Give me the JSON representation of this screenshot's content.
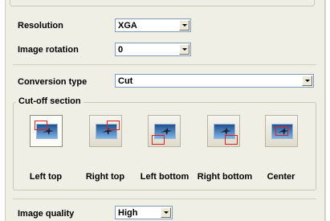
{
  "resolution": {
    "label": "Resolution",
    "value": "XGA"
  },
  "image_rotation": {
    "label": "Image rotation",
    "value": "0"
  },
  "conversion_type": {
    "label": "Conversion type",
    "value": "Cut"
  },
  "cutoff": {
    "title": "Cut-off section",
    "options": [
      {
        "label": "Left top",
        "icon": "left-top-crop-icon",
        "selected": true
      },
      {
        "label": "Right top",
        "icon": "right-top-crop-icon",
        "selected": false
      },
      {
        "label": "Left bottom",
        "icon": "left-bottom-crop-icon",
        "selected": false
      },
      {
        "label": "Right bottom",
        "icon": "right-bottom-crop-icon",
        "selected": false
      },
      {
        "label": "Center",
        "icon": "center-crop-icon",
        "selected": false
      }
    ]
  },
  "image_quality": {
    "label": "Image quality",
    "value": "High"
  },
  "colors": {
    "panel": "#f0efe6",
    "crop_frame": "#e0201b",
    "combo_border": "#7f9db9"
  }
}
